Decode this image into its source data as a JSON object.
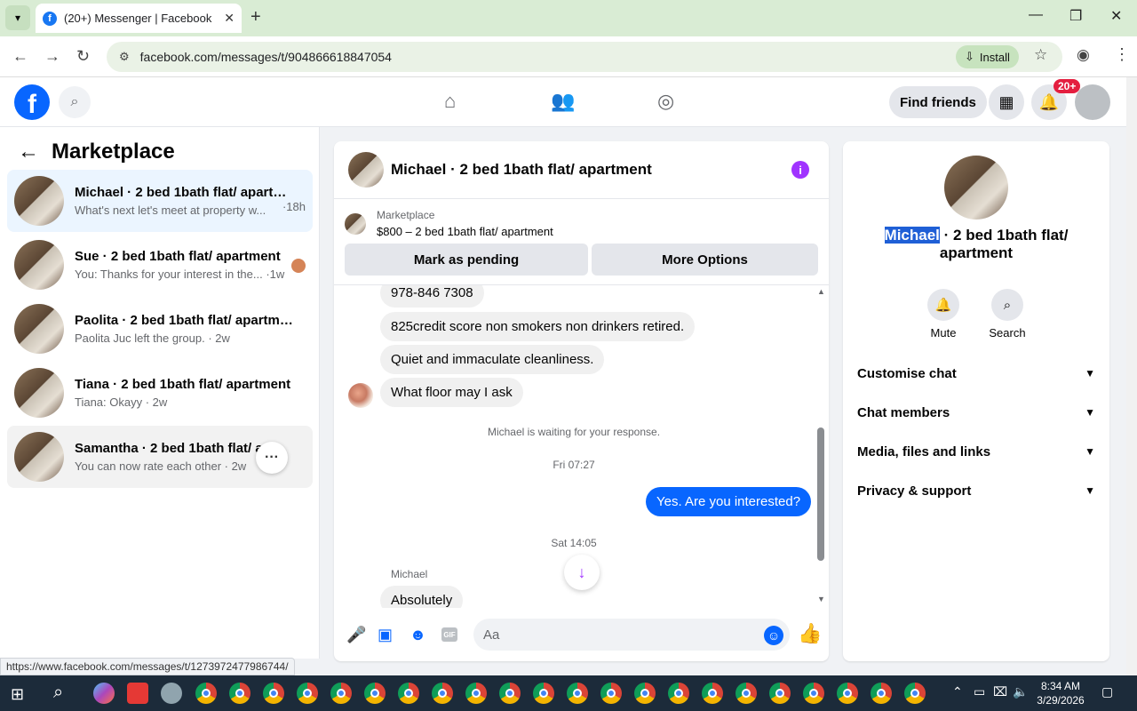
{
  "browser": {
    "tab_title": "(20+) Messenger | Facebook",
    "url": "facebook.com/messages/t/904866618847054",
    "install_label": "Install",
    "status_url": "https://www.facebook.com/messages/t/1273972477986744/"
  },
  "header": {
    "find_friends": "Find friends",
    "notif_count": "20+"
  },
  "sidebar": {
    "title": "Marketplace",
    "conversations": [
      {
        "name": "Michael · 2 bed 1bath flat/ apartm...",
        "snippet": "What's next let's meet at property w...",
        "time": "·18h"
      },
      {
        "name": "Sue · 2 bed 1bath flat/ apartment",
        "snippet": "You: Thanks for your interest in the... ·1w",
        "time": ""
      },
      {
        "name": "Paolita · 2 bed 1bath flat/ apartment",
        "snippet": "Paolita Juc left the group. · 2w",
        "time": ""
      },
      {
        "name": "Tiana · 2 bed 1bath flat/ apartment",
        "snippet": "Tiana: Okayy · 2w",
        "time": ""
      },
      {
        "name": "Samantha · 2 bed 1bath flat/ ap...",
        "snippet": "You can now rate each other · 2w",
        "time": ""
      }
    ]
  },
  "chat": {
    "title": "Michael · 2 bed 1bath flat/ apartment",
    "marketplace_label": "Marketplace",
    "listing": "$800 – 2 bed 1bath flat/ apartment",
    "mark_pending": "Mark as pending",
    "more_options": "More Options",
    "messages": {
      "m1": "978-846 7308",
      "m2": "825credit score non smokers non drinkers retired.",
      "m3": "Quiet and immaculate cleanliness.",
      "m4": "What floor may I ask",
      "waiting": "Michael is waiting for your response.",
      "time1": "Fri 07:27",
      "out1": "Yes. Are you interested?",
      "time2": "Sat 14:05",
      "sender": "Michael",
      "m5": "Absolutely"
    },
    "input_placeholder": "Aa"
  },
  "right_panel": {
    "name_highlight": "Michael",
    "name_rest": " · 2 bed 1bath flat/ apartment",
    "mute": "Mute",
    "search": "Search",
    "sections": [
      "Customise chat",
      "Chat members",
      "Media, files and links",
      "Privacy & support"
    ]
  },
  "taskbar": {
    "time": "8:34 AM",
    "date": "3/29/2026"
  },
  "colors": {
    "accent": "#0866ff",
    "info": "#a033ff",
    "badge": "#e41e3f"
  }
}
